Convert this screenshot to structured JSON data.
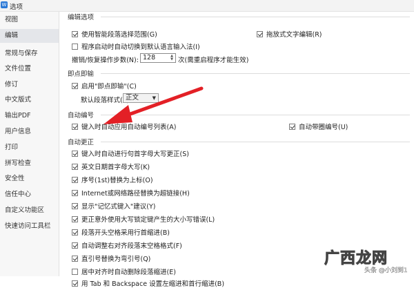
{
  "window": {
    "title": "选项"
  },
  "sidebar": {
    "items": [
      {
        "label": "视图"
      },
      {
        "label": "编辑"
      },
      {
        "label": "常规与保存"
      },
      {
        "label": "文件位置"
      },
      {
        "label": "修订"
      },
      {
        "label": "中文版式"
      },
      {
        "label": "输出PDF"
      },
      {
        "label": "用户信息"
      },
      {
        "label": "打印"
      },
      {
        "label": "拼写检查"
      },
      {
        "label": "安全性"
      },
      {
        "label": "信任中心"
      },
      {
        "label": "自定义功能区"
      },
      {
        "label": "快速访问工具栏"
      }
    ],
    "active_index": 1
  },
  "sections": {
    "edit_options": {
      "heading": "编辑选项",
      "smart_select": "使用智能段落选择范围(G)",
      "drag_text": "拖放式文字编辑(R)",
      "auto_ime": "程序启动时自动切换到默认语言输入法(I)",
      "undo_label": "撤销/恢复操作步数(N):",
      "undo_value": "128",
      "undo_note": "次(需重启程序才能生效)"
    },
    "click_type": {
      "heading": "即点即输",
      "enable": "启用\"即点即输\"(C)",
      "para_style_label": "默认段落样式(P):",
      "para_style_value": "正文"
    },
    "auto_number": {
      "heading": "自动编号",
      "auto_list": "键入时自动应用自动编号列表(A)",
      "circle_number": "自动带圈编号(U)"
    },
    "auto_correct": {
      "heading": "自动更正",
      "items": [
        {
          "label": "键入时自动进行句首字母大写更正(S)",
          "checked": true
        },
        {
          "label": "英文日期首字母大写(K)",
          "checked": true
        },
        {
          "label": "序号(1st)替换为上标(O)",
          "checked": true
        },
        {
          "label": "Internet或网络路径替换为超链接(H)",
          "checked": true
        },
        {
          "label": "显示\"记忆式键入\"建议(Y)",
          "checked": true
        },
        {
          "label": "更正意外使用大写锁定键产生的大小写错误(L)",
          "checked": true
        },
        {
          "label": "段落开头空格采用行首缩进(B)",
          "checked": true
        },
        {
          "label": "自动调整右对齐段落末空格格式(F)",
          "checked": true
        },
        {
          "label": "直引号替换为弯引号(Q)",
          "checked": true
        },
        {
          "label": "居中对齐时自动删除段落缩进(E)",
          "checked": false
        },
        {
          "label": "用 Tab 和 Backspace 设置左缩进和首行缩进(B)",
          "checked": true
        }
      ]
    }
  },
  "watermark": {
    "big": "广西龙网",
    "small": "头条 @小刘到1"
  },
  "colors": {
    "arrow": "#e32026",
    "app_icon": "#2b79d6",
    "sidebar_bg": "#f7f7f7",
    "sidebar_active": "#e4e6ea"
  }
}
